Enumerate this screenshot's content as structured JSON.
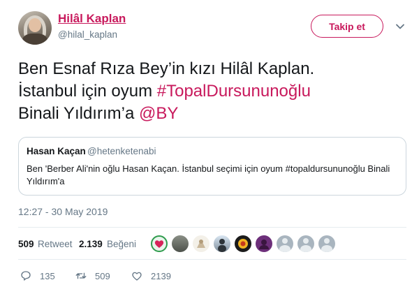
{
  "author": {
    "name": "Hilâl Kaplan",
    "handle": "@hilal_kaplan",
    "follow_label": "Takip et"
  },
  "tweet": {
    "text_part1": "Ben Esnaf Rıza Bey’in kızı Hilâl Kaplan.",
    "text_part2": "İstanbul için oyum ",
    "hashtag": "#TopalDursununoğlu",
    "text_part3": "Binali Yıldırım’a ",
    "mention": "@BY"
  },
  "quoted": {
    "name": "Hasan Kaçan",
    "handle": "@hetenketenabi",
    "text": "Ben 'Berber Ali'nin oğlu Hasan Kaçan. İstanbul seçimi için oyum #topaldursununoğlu Binali Yıldırım'a"
  },
  "timestamp": "12:27 - 30 May 2019",
  "stats": {
    "retweets_count": "509",
    "retweets_label": "Retweet",
    "likes_count": "2.139",
    "likes_label": "Beğeni"
  },
  "actions": {
    "reply_count": "135",
    "retweet_count": "509",
    "like_count": "2139"
  },
  "colors": {
    "accent": "#c8195c",
    "secondary_text": "#657786",
    "divider": "#e6ecf0"
  }
}
